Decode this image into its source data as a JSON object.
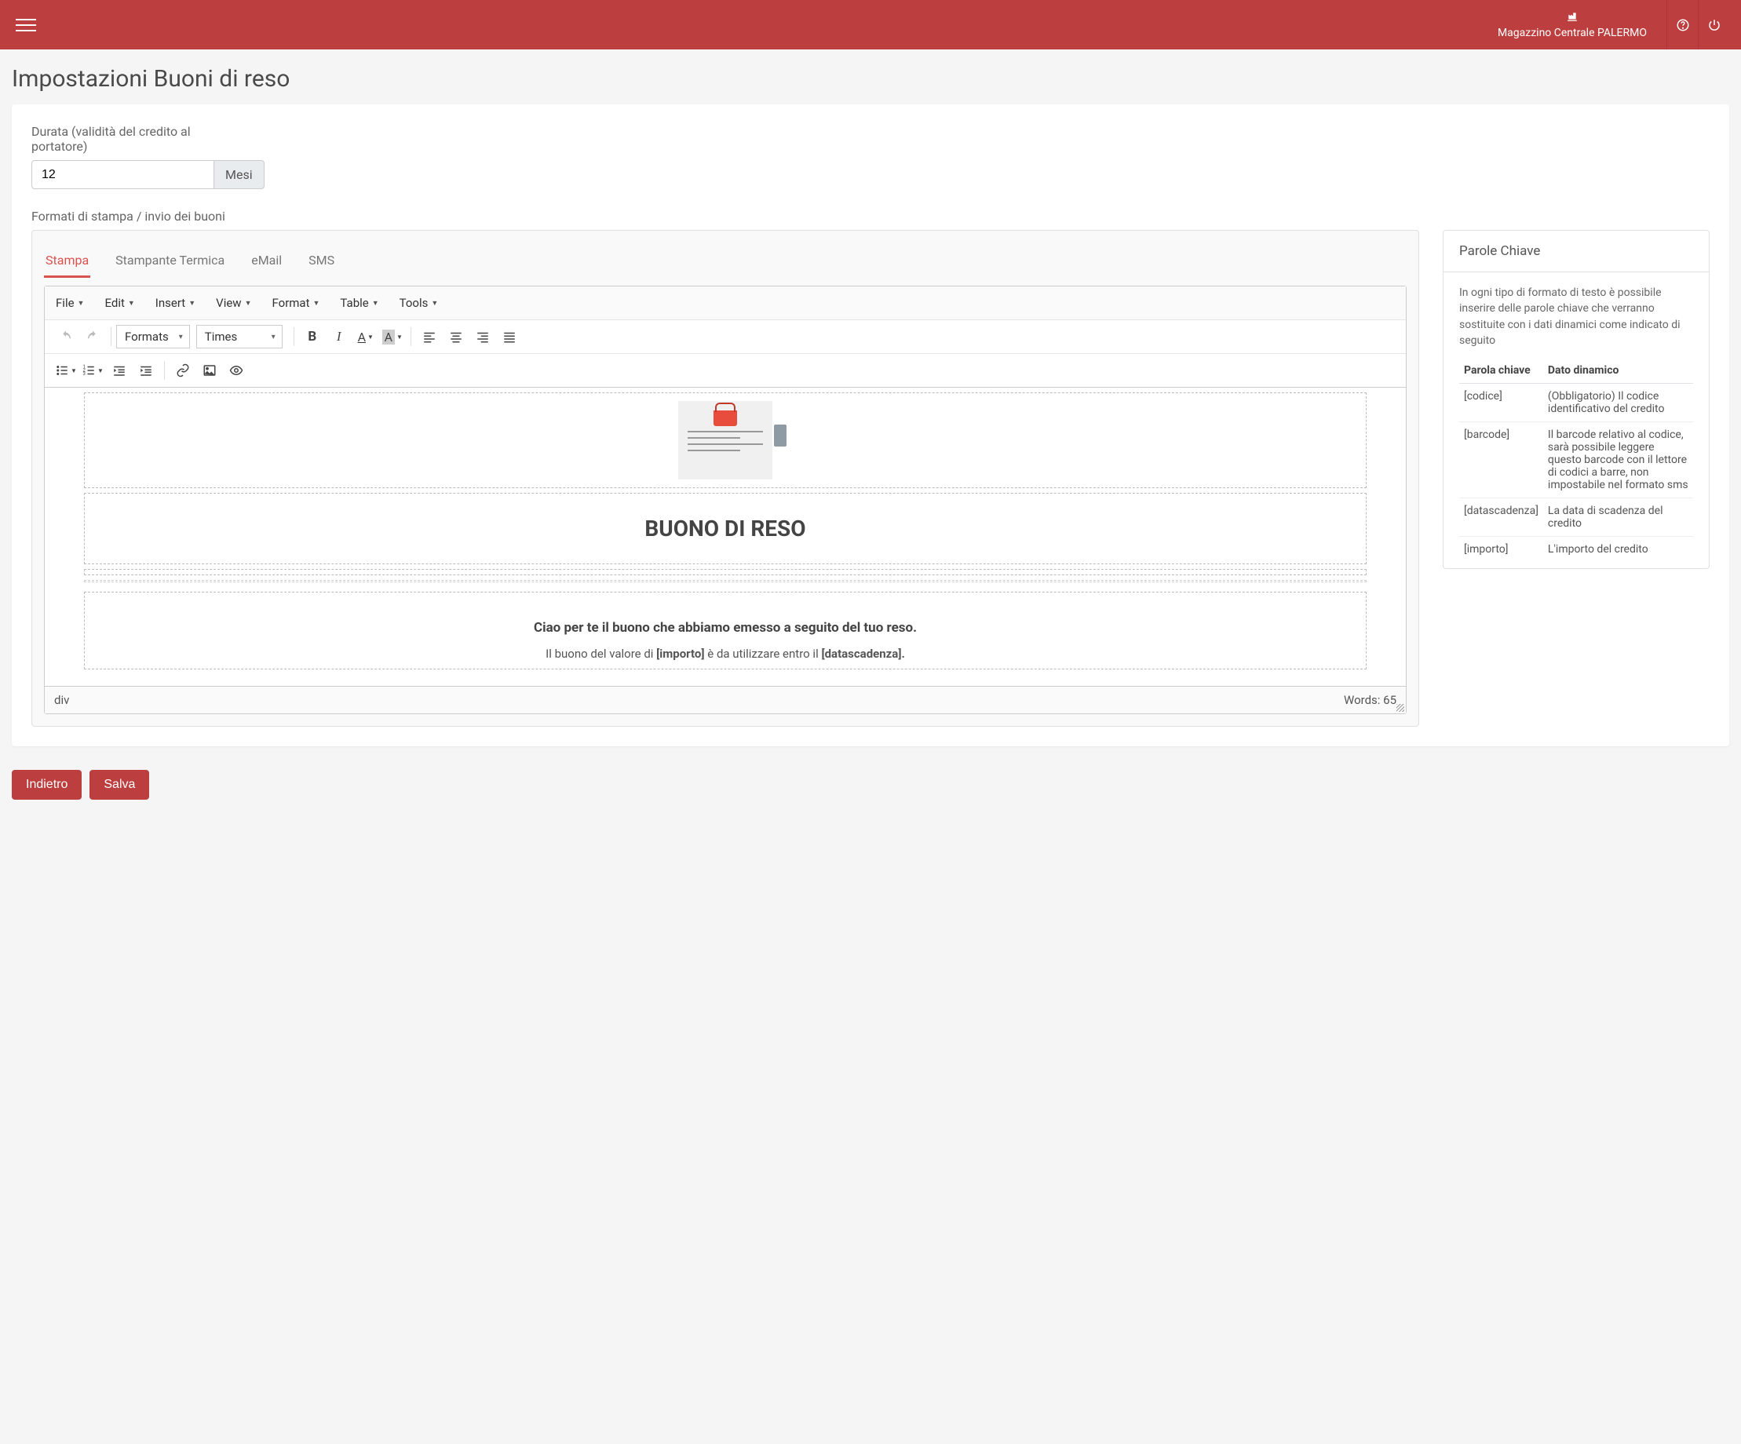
{
  "header": {
    "warehouse_label": "Magazzino Centrale PALERMO"
  },
  "page_title": "Impostazioni Buoni di reso",
  "duration": {
    "label": "Durata (validità del credito al portatore)",
    "value": "12",
    "unit": "Mesi"
  },
  "formats_label": "Formati di stampa / invio dei buoni",
  "tabs": {
    "stampa": "Stampa",
    "termica": "Stampante Termica",
    "email": "eMail",
    "sms": "SMS"
  },
  "editor": {
    "menus": {
      "file": "File",
      "edit": "Edit",
      "insert": "Insert",
      "view": "View",
      "format": "Format",
      "table": "Table",
      "tools": "Tools"
    },
    "formats_btn": "Formats",
    "font_family": "Times",
    "content": {
      "heading": "BUONO DI RESO",
      "line1": "Ciao per te il buono che abbiamo emesso a seguito del tuo reso.",
      "line2_pre": "Il buono del valore di ",
      "line2_var1": "[importo]",
      "line2_mid": " è da utilizzare entro il ",
      "line2_var2": "[datascadenza].",
      "status_path": "div",
      "words_label": "Words: 65"
    }
  },
  "keywords": {
    "title": "Parole Chiave",
    "desc": "In ogni tipo di formato di testo è possibile inserire delle parole chiave che verranno sostituite con i dati dinamici come indicato di seguito",
    "col1": "Parola chiave",
    "col2": "Dato dinamico",
    "rows": [
      {
        "k": "[codice]",
        "d": "(Obbligatorio) Il codice identificativo del credito"
      },
      {
        "k": "[barcode]",
        "d": "Il barcode relativo al codice, sarà possibile leggere questo barcode con il lettore di codici a barre, non impostabile nel formato sms"
      },
      {
        "k": "[datascadenza]",
        "d": "La data di scadenza del credito"
      },
      {
        "k": "[importo]",
        "d": "L'importo del credito"
      }
    ]
  },
  "actions": {
    "back": "Indietro",
    "save": "Salva"
  }
}
